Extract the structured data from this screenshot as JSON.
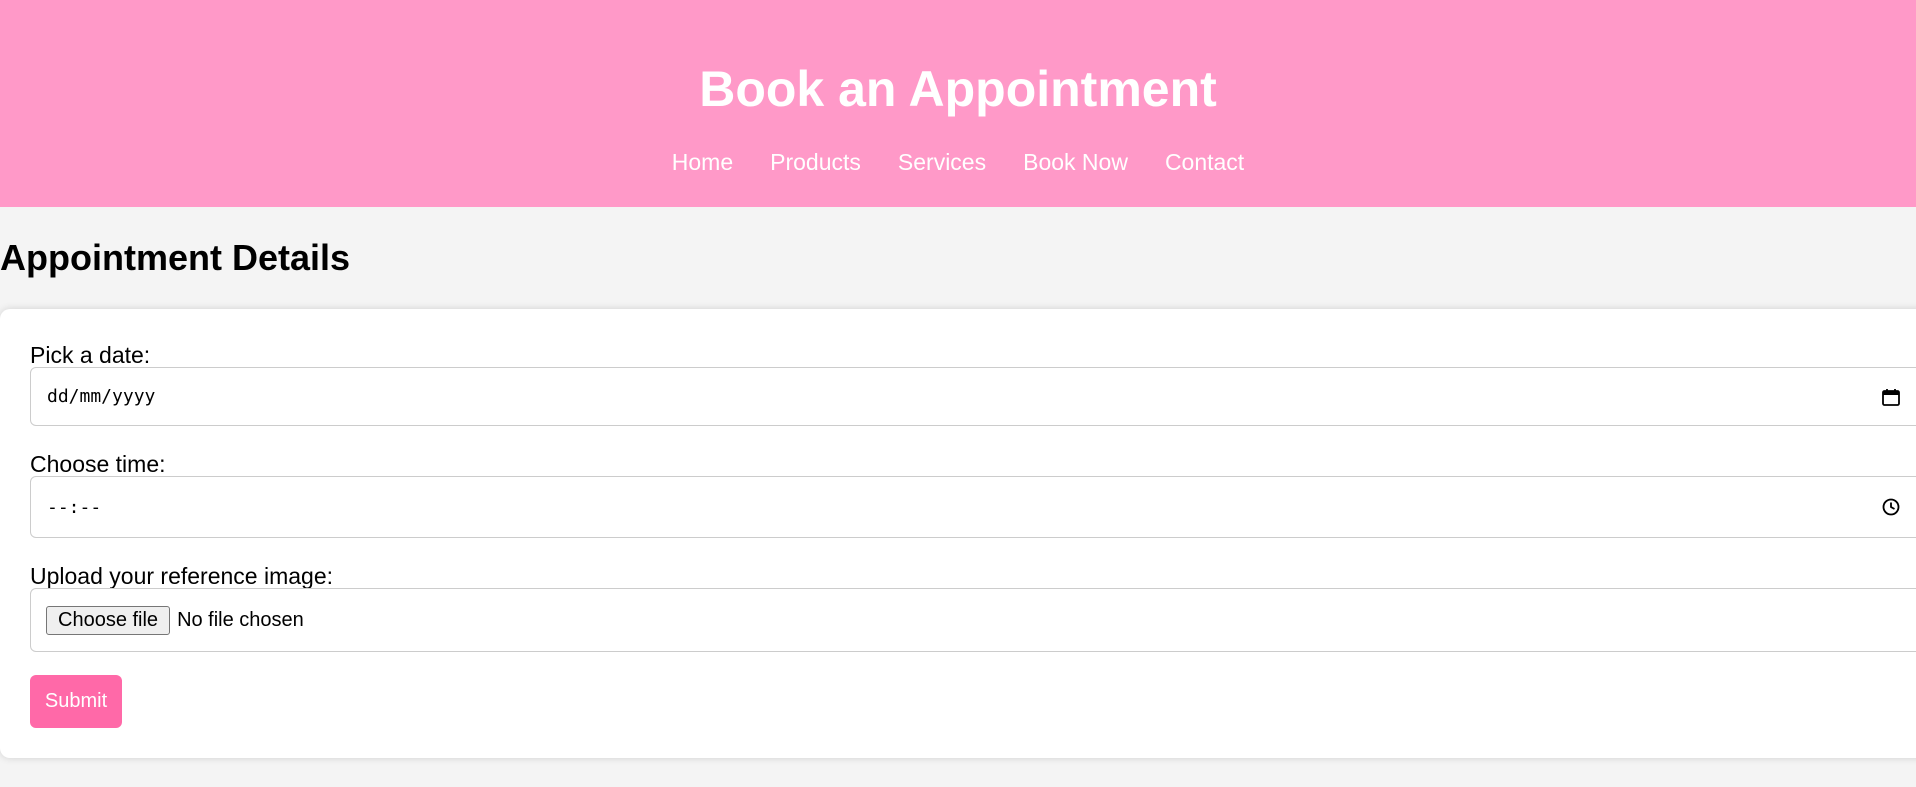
{
  "header": {
    "title": "Book an Appointment",
    "background": "#ff99c8",
    "nav": [
      "Home",
      "Products",
      "Services",
      "Book Now",
      "Contact"
    ]
  },
  "main": {
    "section_title": "Appointment Details",
    "form": {
      "date_label": "Pick a date:",
      "date_value": "dd/mm/yyyy",
      "time_label": "Choose time:",
      "time_value": "--:--",
      "file_label": "Upload your reference image:",
      "file_button": "Choose file",
      "file_status": "No file chosen",
      "submit_label": "Submit",
      "submit_color": "#ff69a8"
    }
  },
  "icons": {
    "date_picker": "calendar-icon",
    "time_picker": "clock-icon"
  }
}
